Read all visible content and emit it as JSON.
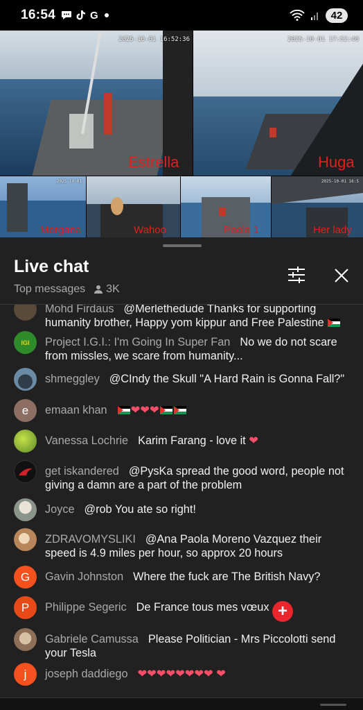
{
  "status_bar": {
    "time": "16:54",
    "notification_icons": [
      "chat-bubble-icon",
      "tiktok-icon",
      "google-icon",
      "dot-icon"
    ],
    "battery": "42"
  },
  "video": {
    "cameras": [
      {
        "label": "Estrella",
        "timestamp": "2025-10-01 16:52:36"
      },
      {
        "label": "Huga",
        "timestamp": "2025-10-01 17:52:40"
      },
      {
        "label": "Morgana",
        "timestamp": "2025-10-01"
      },
      {
        "label": "Wahoo",
        "timestamp": ""
      },
      {
        "label": "Paola 1",
        "timestamp": ""
      },
      {
        "label": "Her lady",
        "timestamp": "2025-10-01 16:5"
      }
    ]
  },
  "chat": {
    "title": "Live chat",
    "mode": "Top messages",
    "viewers": "3K",
    "messages": [
      {
        "author": "Mohd Firdaus",
        "text": "@Merlethedude Thanks for supporting humanity brother, Happy yom kippur and Free Palestine",
        "avatar_color": "#5a4a3a",
        "initial": ""
      },
      {
        "author": "Project I.G.I.: I'm Going In Super Fan",
        "text": "No we do not scare from missles, we scare from humanity...",
        "avatar_color": "#2f8a2a",
        "initial": "IGI"
      },
      {
        "author": "shmeggley",
        "text": "@CIndy the Skull \"A Hard Rain is Gonna Fall?\"",
        "avatar_color": "#4a6b8a",
        "initial": ""
      },
      {
        "author": "emaan khan",
        "text": "",
        "avatar_color": "#8d6e63",
        "initial": "e"
      },
      {
        "author": "Vanessa Lochrie",
        "text": "Karim Farang - love it",
        "avatar_color": "#7cb342",
        "initial": ""
      },
      {
        "author": "get iskandered",
        "text": "@PysKa spread the good word, people not giving a damn are a part of the problem",
        "avatar_color": "#111111",
        "initial": ""
      },
      {
        "author": "Joyce",
        "text": "@rob You ate so right!",
        "avatar_color": "#9aa39a",
        "initial": ""
      },
      {
        "author": "ZDRAVOMYSLIKI",
        "text": "@Ana Paola Moreno Vazquez their speed is 4.9 miles per hour, so approx 20 hours",
        "avatar_color": "#c9a27a",
        "initial": ""
      },
      {
        "author": "Gavin Johnston",
        "text": "Where the fuck are The British Navy?",
        "avatar_color": "#f4511e",
        "initial": "G"
      },
      {
        "author": "Philippe Segeric",
        "text": "De France tous mes vœux",
        "avatar_color": "#e64a19",
        "initial": "P"
      },
      {
        "author": "Gabriele Camussa",
        "text": "Please Politician - Mrs Piccolotti send your Tesla",
        "avatar_color": "#b08a6a",
        "initial": ""
      },
      {
        "author": "joseph daddiego",
        "text": "",
        "avatar_color": "#f4511e",
        "initial": "j"
      }
    ]
  }
}
